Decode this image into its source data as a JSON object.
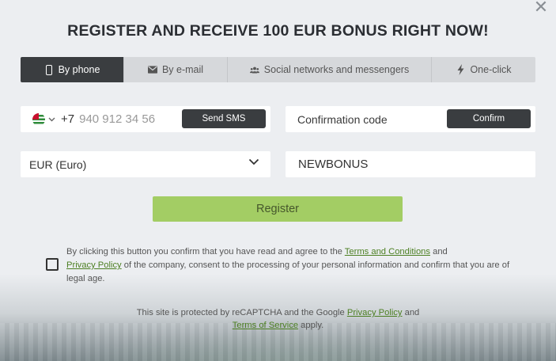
{
  "modal": {
    "title": "REGISTER AND RECEIVE 100 EUR BONUS RIGHT NOW!",
    "close_glyph": "✕"
  },
  "tabs": [
    {
      "label": "By phone",
      "icon": "phone-icon",
      "active": true
    },
    {
      "label": "By e-mail",
      "icon": "envelope-icon",
      "active": false
    },
    {
      "label": "Social networks and messengers",
      "icon": "users-icon",
      "active": false
    },
    {
      "label": "One-click",
      "icon": "lightning-icon",
      "active": false
    }
  ],
  "phone": {
    "country_flag": "abkhazia-flag-icon",
    "country_code": "+7",
    "placeholder": "940 912 34 56",
    "send_sms_label": "Send SMS"
  },
  "confirmation": {
    "placeholder": "Confirmation code",
    "confirm_label": "Confirm"
  },
  "currency": {
    "selected": "EUR (Euro)"
  },
  "promo": {
    "value": "NEWBONUS"
  },
  "register": {
    "label": "Register"
  },
  "agreement": {
    "checked": false,
    "text_before": "By clicking this button you confirm that you have read and agree to the ",
    "terms_link": "Terms and Conditions",
    "text_and": " and ",
    "privacy_link": "Privacy Policy",
    "text_after": " of the company, consent to the processing of your personal information and confirm that you are of legal age."
  },
  "recaptcha": {
    "text_before": "This site is protected by reCAPTCHA and the Google ",
    "privacy_link": "Privacy Policy",
    "text_and": " and",
    "terms_link": "Terms of Service",
    "text_after": " apply."
  },
  "colors": {
    "accent_green": "#a3cd64",
    "link_green": "#4c7f22",
    "dark_button": "#3a3d40",
    "background": "#eceef1"
  }
}
